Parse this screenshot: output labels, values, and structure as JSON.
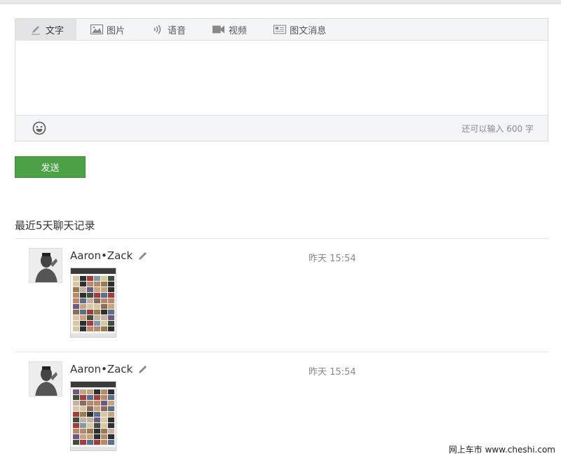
{
  "composer": {
    "tabs": [
      {
        "label": "文字",
        "icon": "pencil-icon"
      },
      {
        "label": "图片",
        "icon": "image-icon"
      },
      {
        "label": "语音",
        "icon": "audio-icon"
      },
      {
        "label": "视频",
        "icon": "video-icon"
      },
      {
        "label": "图文消息",
        "icon": "article-icon"
      }
    ],
    "active_tab": "文字",
    "remaining_text": "还可以输入 600 字",
    "emoji_icon": "smiley-icon"
  },
  "send_label": "发送",
  "history": {
    "title": "最近5天聊天记录",
    "messages": [
      {
        "nickname": "Aaron•Zack",
        "time": "昨天 15:54"
      },
      {
        "nickname": "Aaron•Zack",
        "time": "昨天 15:54"
      }
    ]
  },
  "watermark": "网上车市 www.cheshi.com",
  "colors": {
    "send_button": "#4ca146",
    "tab_bar": "#f4f5f7",
    "active_tab": "#e3e4e6",
    "border": "#d9dadc"
  }
}
